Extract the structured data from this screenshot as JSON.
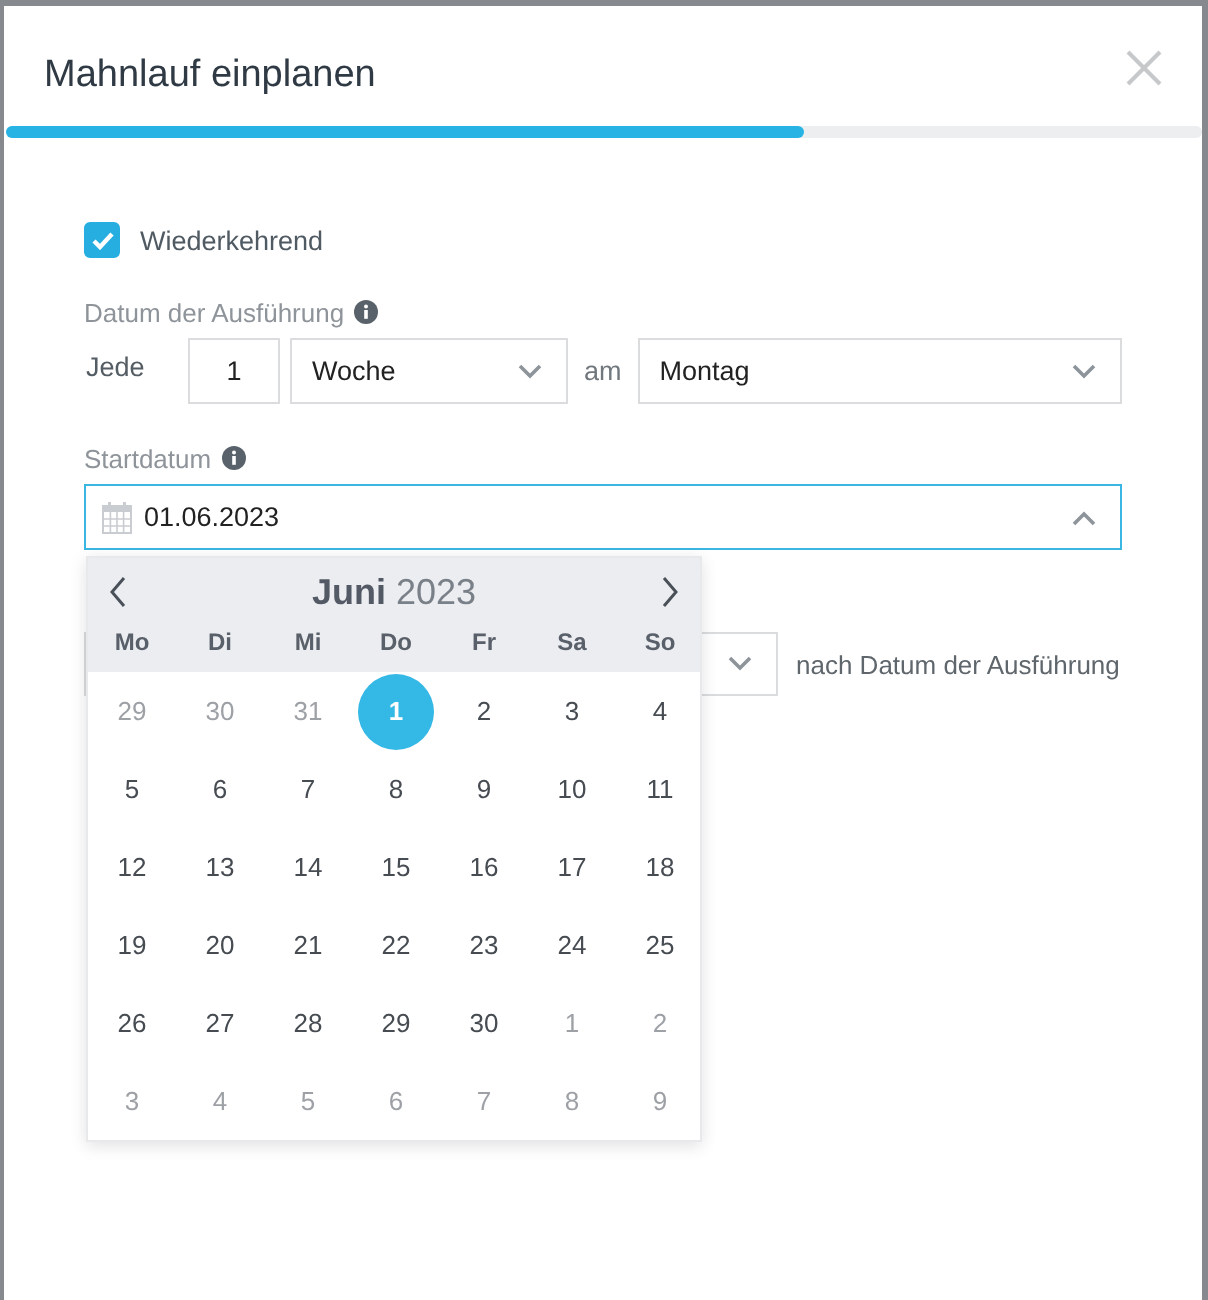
{
  "dialog": {
    "title": "Mahnlauf einplanen",
    "progress": {
      "level": 0.667
    }
  },
  "recurring": {
    "label": "Wiederkehrend",
    "checked": true
  },
  "execution": {
    "label": "Datum der Ausführung",
    "prefix": "Jede",
    "interval": "1",
    "unit": "Woche",
    "connector": "am",
    "weekday": "Montag"
  },
  "start_date": {
    "label": "Startdatum",
    "value": "01.06.2023",
    "expanded": true
  },
  "offset": {
    "suffix": "nach Datum der Ausführung"
  },
  "calendar": {
    "title": "**Juni** 2023",
    "weekdays": [
      "Mo",
      "Di",
      "Mi",
      "Do",
      "Fr",
      "Sa",
      "So"
    ],
    "weeks": [
      [
        {
          "day": "29",
          "in_month": false,
          "selected": false
        },
        {
          "day": "30",
          "in_month": false,
          "selected": false
        },
        {
          "day": "31",
          "in_month": false,
          "selected": false
        },
        {
          "day": "1",
          "in_month": true,
          "selected": true
        },
        {
          "day": "2",
          "in_month": true,
          "selected": false
        },
        {
          "day": "3",
          "in_month": true,
          "selected": false
        },
        {
          "day": "4",
          "in_month": true,
          "selected": false
        }
      ],
      [
        {
          "day": "5",
          "in_month": true,
          "selected": false
        },
        {
          "day": "6",
          "in_month": true,
          "selected": false
        },
        {
          "day": "7",
          "in_month": true,
          "selected": false
        },
        {
          "day": "8",
          "in_month": true,
          "selected": false
        },
        {
          "day": "9",
          "in_month": true,
          "selected": false
        },
        {
          "day": "10",
          "in_month": true,
          "selected": false
        },
        {
          "day": "11",
          "in_month": true,
          "selected": false
        }
      ],
      [
        {
          "day": "12",
          "in_month": true,
          "selected": false
        },
        {
          "day": "13",
          "in_month": true,
          "selected": false
        },
        {
          "day": "14",
          "in_month": true,
          "selected": false
        },
        {
          "day": "15",
          "in_month": true,
          "selected": false
        },
        {
          "day": "16",
          "in_month": true,
          "selected": false
        },
        {
          "day": "17",
          "in_month": true,
          "selected": false
        },
        {
          "day": "18",
          "in_month": true,
          "selected": false
        }
      ],
      [
        {
          "day": "19",
          "in_month": true,
          "selected": false
        },
        {
          "day": "20",
          "in_month": true,
          "selected": false
        },
        {
          "day": "21",
          "in_month": true,
          "selected": false
        },
        {
          "day": "22",
          "in_month": true,
          "selected": false
        },
        {
          "day": "23",
          "in_month": true,
          "selected": false
        },
        {
          "day": "24",
          "in_month": true,
          "selected": false
        },
        {
          "day": "25",
          "in_month": true,
          "selected": false
        }
      ],
      [
        {
          "day": "26",
          "in_month": true,
          "selected": false
        },
        {
          "day": "27",
          "in_month": true,
          "selected": false
        },
        {
          "day": "28",
          "in_month": true,
          "selected": false
        },
        {
          "day": "29",
          "in_month": true,
          "selected": false
        },
        {
          "day": "30",
          "in_month": true,
          "selected": false
        },
        {
          "day": "1",
          "in_month": false,
          "selected": false
        },
        {
          "day": "2",
          "in_month": false,
          "selected": false
        }
      ],
      [
        {
          "day": "3",
          "in_month": false,
          "selected": false
        },
        {
          "day": "4",
          "in_month": false,
          "selected": false
        },
        {
          "day": "5",
          "in_month": false,
          "selected": false
        },
        {
          "day": "6",
          "in_month": false,
          "selected": false
        },
        {
          "day": "7",
          "in_month": false,
          "selected": false
        },
        {
          "day": "8",
          "in_month": false,
          "selected": false
        },
        {
          "day": "9",
          "in_month": false,
          "selected": false
        }
      ]
    ]
  }
}
